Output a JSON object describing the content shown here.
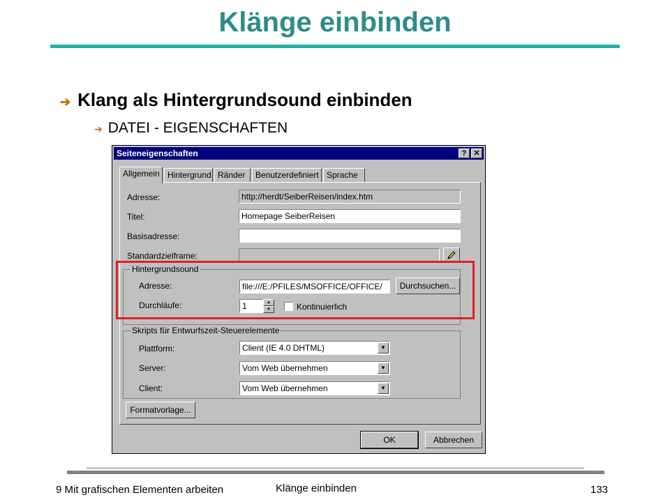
{
  "slide": {
    "title": "Klänge einbinden",
    "bullet1": "Klang als Hintergrundsound einbinden",
    "bullet2": "DATEI - EIGENSCHAFTEN",
    "arrow_glyph": "➔"
  },
  "dialog": {
    "title": "Seiteneigenschaften",
    "help_glyph": "?",
    "close_glyph": "✕",
    "tabs": [
      "Allgemein",
      "Hintergrund",
      "Ränder",
      "Benutzerdefiniert",
      "Sprache"
    ],
    "active_tab": "Allgemein",
    "fields": {
      "adresse_label": "Adresse:",
      "adresse_value": "http://herdt/SeiberReisen/index.htm",
      "titel_label": "Titel:",
      "titel_value": "Homepage SeiberReisen",
      "basisadresse_label": "Basisadresse:",
      "basisadresse_value": "",
      "zielframe_label": "Standardzielframe:",
      "zielframe_value": ""
    },
    "sound_group": {
      "title": "Hintergrundsound",
      "adresse_label": "Adresse:",
      "adresse_value": "file:///E:/PFILES/MSOFFICE/OFFICE/",
      "browse_label": "Durchsuchen...",
      "loops_label": "Durchläufe:",
      "loops_value": "1",
      "continuous_label": "Kontinuierlich",
      "continuous_checked": false
    },
    "script_group": {
      "title": "Skripts für Entwurfszeit-Steuerelemente",
      "plattform_label": "Plattform:",
      "plattform_value": "Client (IE 4.0 DHTML)",
      "server_label": "Server:",
      "server_value": "Vom Web übernehmen",
      "client_label": "Client:",
      "client_value": "Vom Web übernehmen"
    },
    "format_button": "Formatvorlage...",
    "ok_button": "OK",
    "cancel_button": "Abbrechen",
    "highlight_color": "#e02020"
  },
  "footer": {
    "left": "9 Mit grafischen Elementen arbeiten",
    "center": "Klänge einbinden",
    "page": "133"
  }
}
